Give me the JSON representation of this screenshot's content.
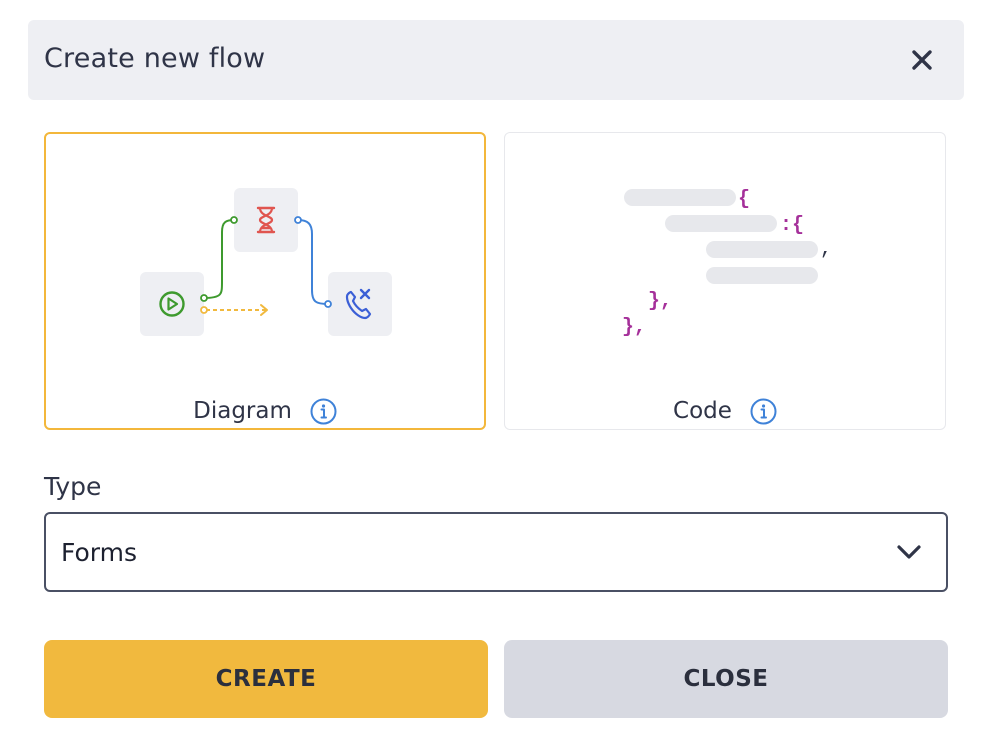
{
  "dialog": {
    "title": "Create new flow",
    "close_icon": "close-icon"
  },
  "modes": [
    {
      "label": "Diagram",
      "selected": true,
      "info_icon": "info-icon",
      "illustration": "flow-diagram-illustration"
    },
    {
      "label": "Code",
      "selected": false,
      "info_icon": "info-icon",
      "illustration": "code-json-illustration"
    }
  ],
  "code_illustration": {
    "line1_brace": "{",
    "line2_brace": ":{",
    "line3_comma": ",",
    "line5_close": "},",
    "line6_close": "},"
  },
  "type_field": {
    "label": "Type",
    "value": "Forms",
    "chevron_icon": "chevron-down-icon"
  },
  "buttons": {
    "create_label": "CREATE",
    "close_label": "CLOSE"
  },
  "colors": {
    "accent": "#f1b93e",
    "selected_border": "#f3b73b",
    "header_bg": "#eeeff3",
    "secondary_button": "#d7d9e1",
    "info_blue": "#3f82d8",
    "code_purple": "#a5309a",
    "node_green": "#3e9a2e",
    "node_red": "#e0554f",
    "node_blue": "#3b5fd6"
  }
}
